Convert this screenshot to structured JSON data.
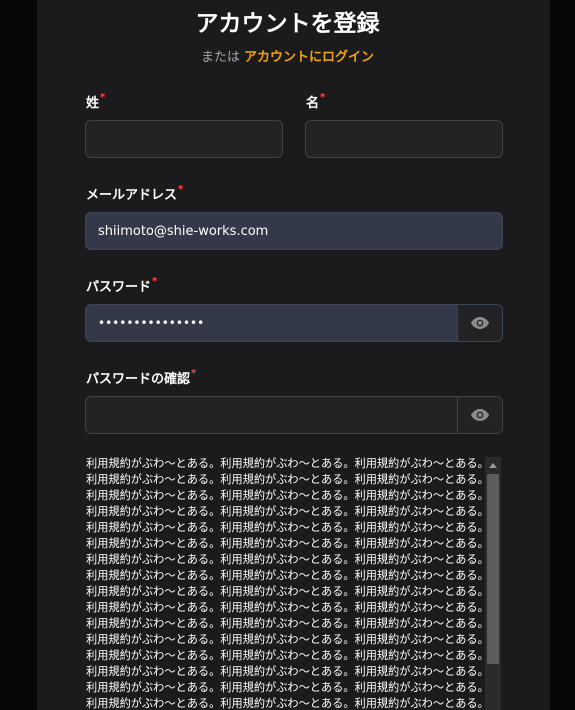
{
  "header": {
    "title": "アカウントを登録",
    "subtitle_prefix": "または",
    "login_link": "アカウントにログイン"
  },
  "form": {
    "last_name": {
      "label": "姓",
      "required_mark": "*",
      "value": ""
    },
    "first_name": {
      "label": "名",
      "required_mark": "*",
      "value": ""
    },
    "email": {
      "label": "メールアドレス",
      "required_mark": "*",
      "value": "shiimoto@shie-works.com"
    },
    "password": {
      "label": "パスワード",
      "required_mark": "*",
      "value": "•••••••••••••••"
    },
    "password_confirm": {
      "label": "パスワードの確認",
      "required_mark": "*",
      "value": ""
    }
  },
  "icons": {
    "password_toggle": "eye-icon",
    "scroll_up": "triangle-up-icon"
  },
  "terms": {
    "lines": [
      "利用規約がぶわ～とある。利用規約がぶわ～とある。利用規約がぶわ～とある。",
      "利用規約がぶわ～とある。利用規約がぶわ～とある。利用規約がぶわ～とある。",
      "利用規約がぶわ～とある。利用規約がぶわ～とある。利用規約がぶわ～とある。",
      "利用規約がぶわ～とある。利用規約がぶわ～とある。利用規約がぶわ～とある。",
      "利用規約がぶわ～とある。利用規約がぶわ～とある。利用規約がぶわ～とある。",
      "利用規約がぶわ～とある。利用規約がぶわ～とある。利用規約がぶわ～とある。",
      "利用規約がぶわ～とある。利用規約がぶわ～とある。利用規約がぶわ～とある。",
      "利用規約がぶわ～とある。利用規約がぶわ～とある。利用規約がぶわ～とある。",
      "利用規約がぶわ～とある。利用規約がぶわ～とある。利用規約がぶわ～とある。",
      "利用規約がぶわ～とある。利用規約がぶわ～とある。利用規約がぶわ～とある。",
      "利用規約がぶわ～とある。利用規約がぶわ～とある。利用規約がぶわ～とある。",
      "利用規約がぶわ～とある。利用規約がぶわ～とある。利用規約がぶわ～とある。",
      "利用規約がぶわ～とある。利用規約がぶわ～とある。利用規約がぶわ～とある。",
      "利用規約がぶわ～とある。利用規約がぶわ～とある。利用規約がぶわ～とある。",
      "利用規約がぶわ～とある。利用規約がぶわ～とある。利用規約がぶわ～とある。",
      "利用規約がぶわ～とある。利用規約がぶわ～とある。利用規約がぶわ～とある。"
    ]
  },
  "colors": {
    "accent": "#f2a311",
    "required": "#ff4d4d",
    "panel_bg": "#1b1b1d",
    "page_bg": "#070707",
    "filled_input_bg": "#333948"
  }
}
